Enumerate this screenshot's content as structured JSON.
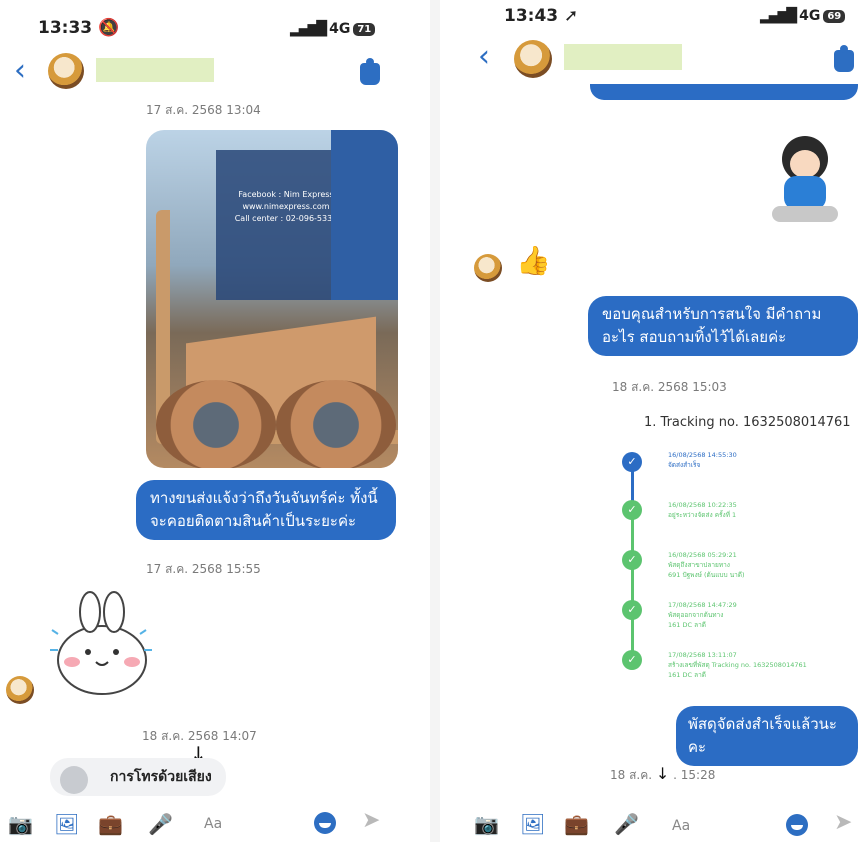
{
  "left": {
    "status": {
      "time": "13:33",
      "mute_icon": "bell-slash-icon",
      "network": "4G",
      "battery": "71"
    },
    "messages": {
      "ts1": "17 ส.ค. 2568 13:04",
      "photo_text": {
        "line1": "Facebook : Nim Express",
        "line2": "www.nimexpress.com",
        "line3": "Call center : 02-096-5333"
      },
      "bubble1": "ทางขนส่งแจ้งว่าถึงวันจันทร์ค่ะ ทั้งนี้จะคอยติดตามสินค้าเป็นระยะค่ะ",
      "ts2": "17 ส.ค. 2568 15:55",
      "ts3": "18 ส.ค. 2568 14:07",
      "call_label": "การโทรด้วยเสียง"
    },
    "composer": {
      "placeholder": "Aa"
    }
  },
  "right": {
    "status": {
      "time": "13:43",
      "location_icon": "location-arrow-icon",
      "network": "4G",
      "battery": "69"
    },
    "messages": {
      "bubble1": "ขอบคุณสำหรับการสนใจ มีคำถามอะไร สอบถามทิ้งไว้ได้เลยค่ะ",
      "ts1": "18 ส.ค. 2568 15:03",
      "tracking_title": "1. Tracking no. 1632508014761",
      "timeline": [
        {
          "date": "16/08/2568 14:55:30",
          "text": "จัดส่งสำเร็จ",
          "color": "blue"
        },
        {
          "date": "16/08/2568 10:22:35",
          "text": "อยู่ระหว่างจัดส่ง ครั้งที่ 1",
          "color": "green"
        },
        {
          "date": "16/08/2568 05:29:21",
          "text": "พัสดุถึงสาขาปลายทาง",
          "text2": "691 ปัฐพงษ์ (ต้นแบบ นาดี)",
          "color": "green"
        },
        {
          "date": "17/08/2568 14:47:29",
          "text": "พัสดุออกจากต้นทาง",
          "text2": "161 DC ลาดี",
          "color": "green"
        },
        {
          "date": "17/08/2568 13:11:07",
          "text": "สร้างเลขที่พัสดุ Tracking no. 1632508014761",
          "text2": "161 DC ลาดี",
          "color": "green"
        }
      ],
      "bubble2": "พัสดุจัดส่งสำเร็จแล้วนะคะ",
      "ts2": "18 ส.ค. 2568 15:28",
      "ts2_date": "18 ส.ค.",
      "ts2_time": ". 15:28"
    },
    "composer": {
      "placeholder": "Aa"
    }
  },
  "colors": {
    "accent": "#2b6cc4",
    "success": "#5cc46f",
    "name_redaction": "#e1efc2"
  }
}
